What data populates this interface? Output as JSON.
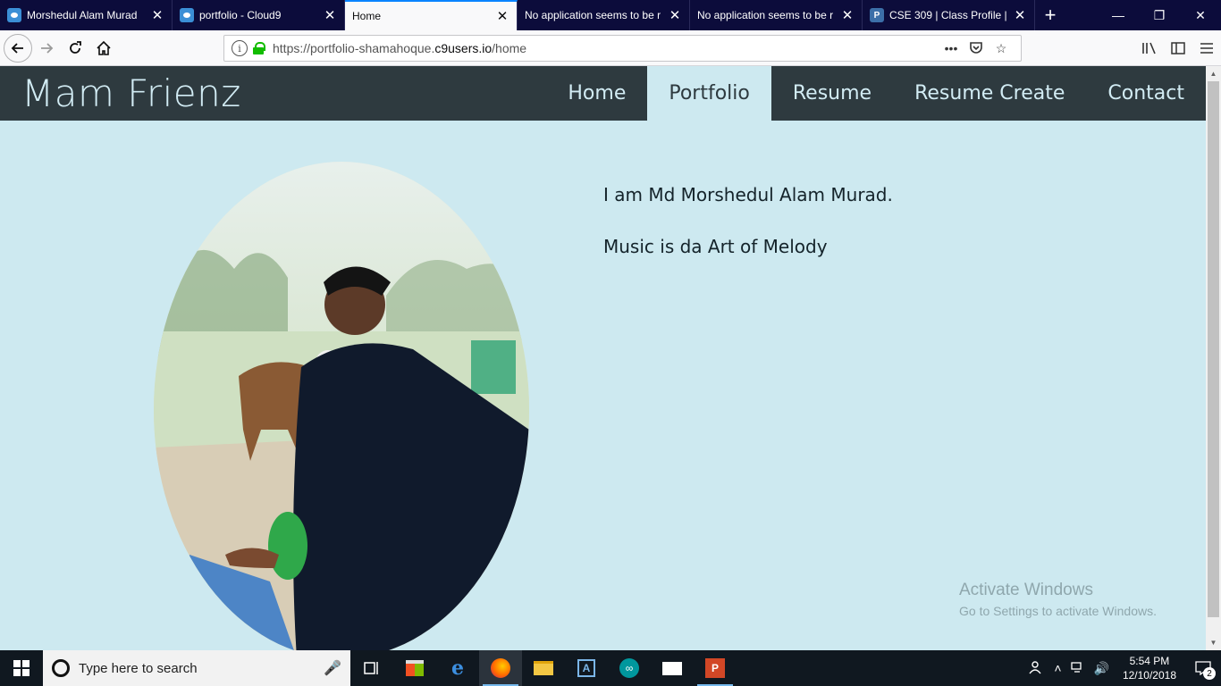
{
  "browser": {
    "tabs": [
      {
        "title": "Morshedul Alam Murad",
        "favicon": "cloud9-eye-icon",
        "active": false
      },
      {
        "title": "portfolio - Cloud9",
        "favicon": "cloud9-eye-icon",
        "active": false
      },
      {
        "title": "Home",
        "favicon": "",
        "active": true
      },
      {
        "title": "No application seems to be r",
        "favicon": "",
        "active": false
      },
      {
        "title": "No application seems to be r",
        "favicon": "",
        "active": false
      },
      {
        "title": "CSE 309 | Class Profile | P",
        "favicon": "piazza-p-icon",
        "active": false
      }
    ],
    "new_tab_label": "+",
    "url_prefix": "https://portfolio-shamahoque.",
    "url_domain": "c9users.io",
    "url_path": "/home",
    "window_controls": {
      "minimize": "—",
      "restore": "❐",
      "close": "✕"
    }
  },
  "site": {
    "brand": "Mam Frienz",
    "nav": [
      {
        "label": "Home",
        "active": false
      },
      {
        "label": "Portfolio",
        "active": true
      },
      {
        "label": "Resume",
        "active": false
      },
      {
        "label": "Resume Create",
        "active": false
      },
      {
        "label": "Contact",
        "active": false
      }
    ],
    "bio_line_1": "I am Md Morshedul Alam Murad.",
    "bio_line_2": "Music is da Art of Melody"
  },
  "watermark": {
    "title": "Activate Windows",
    "subtitle": "Go to Settings to activate Windows."
  },
  "taskbar": {
    "search_placeholder": "Type here to search",
    "time": "5:54 PM",
    "date": "12/10/2018",
    "notification_count": "2"
  },
  "colors": {
    "page_bg": "#cde9f0",
    "header_bg": "#2e3a3f",
    "header_text": "#d2ecf4",
    "browser_frame": "#0c0c3b",
    "taskbar_bg": "#101820"
  }
}
